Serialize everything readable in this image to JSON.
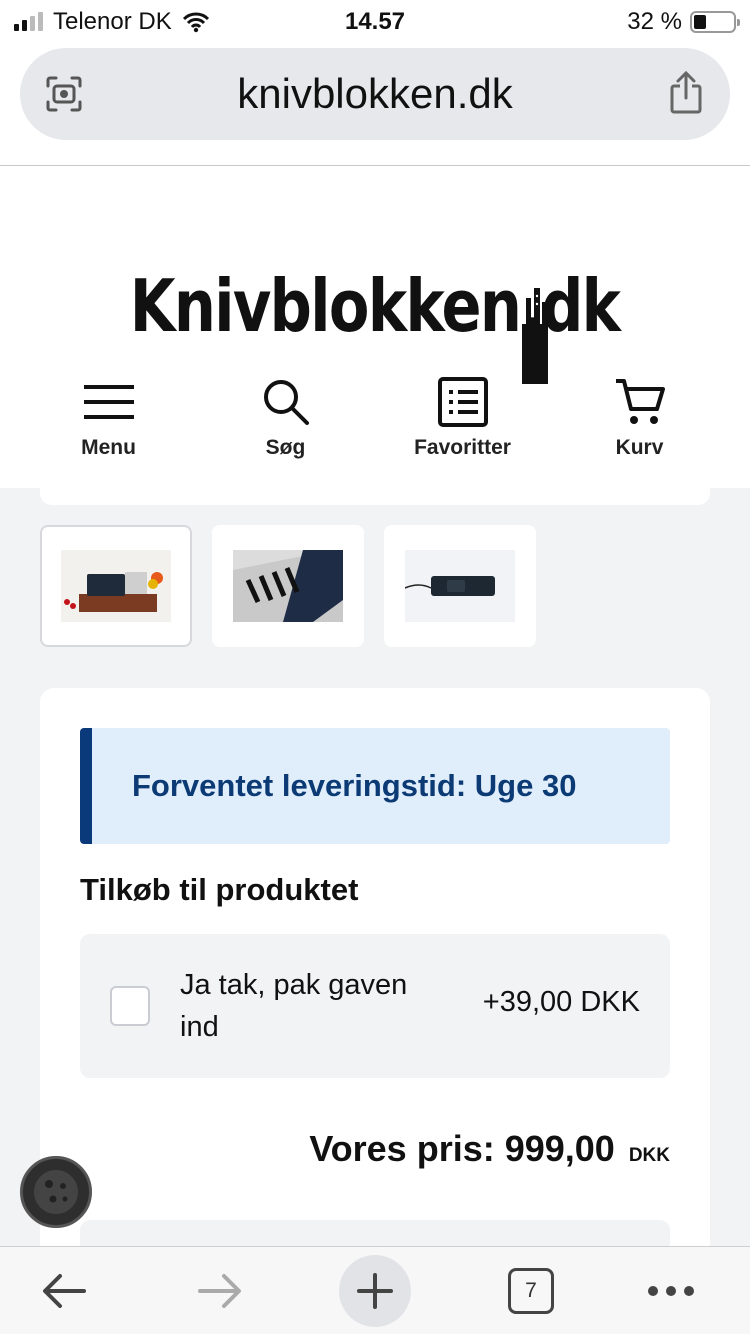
{
  "status_bar": {
    "carrier": "Telenor DK",
    "time": "14.57",
    "battery_percent": "32 %",
    "battery_level": 0.32
  },
  "browser": {
    "url": "knivblokken.dk",
    "left_icon": "visual-lookup-icon",
    "right_icon": "share-icon",
    "tab_count": "7"
  },
  "site": {
    "logo_text": "Knivblokken.dk",
    "nav": [
      {
        "label": "Menu",
        "icon": "hamburger-menu-icon"
      },
      {
        "label": "Søg",
        "icon": "search-icon"
      },
      {
        "label": "Favoritter",
        "icon": "list-icon"
      },
      {
        "label": "Kurv",
        "icon": "cart-icon"
      }
    ]
  },
  "product": {
    "delivery_notice": "Forventet leveringstid: Uge 30",
    "addons_title": "Tilkøb til produktet",
    "addon": {
      "label": "Ja tak, pak gaven ind",
      "price": "+39,00 DKK",
      "checked": false
    },
    "price_label": "Vores pris: 999,00",
    "currency": "DKK"
  },
  "colors": {
    "accent": "#0a3a7a",
    "notice_bg": "#e0eefb",
    "page_bg": "#f1f3f5"
  }
}
